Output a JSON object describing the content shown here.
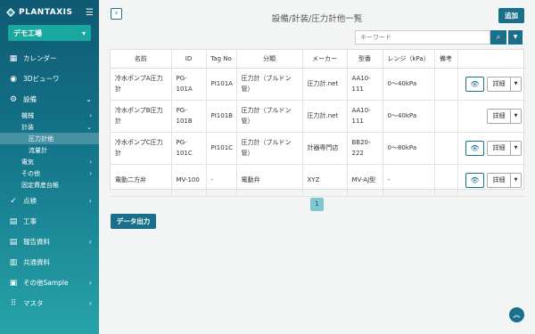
{
  "brand": {
    "name": "PLANTAXIS"
  },
  "factory": {
    "label": "デモ工場"
  },
  "nav": {
    "calendar": "カレンダー",
    "viewer3d": "3Dビューワ",
    "equipment": "設備",
    "machine": "機械",
    "meter": "計装",
    "pressure_meter": "圧力計他",
    "flow_meter": "流量計",
    "electric": "電気",
    "other": "その他",
    "fixed_assets": "固定資産台帳",
    "inspection": "点検",
    "construction": "工事",
    "report": "報告資料",
    "shared": "共通資料",
    "other_sample": "その他Sample",
    "master": "マスタ"
  },
  "header": {
    "title": "設備/計装/圧力計他一覧",
    "add_label": "追加",
    "search_placeholder": "キーワード"
  },
  "table": {
    "headers": {
      "name": "名前",
      "id": "ID",
      "tag": "Tag No",
      "category": "分類",
      "maker": "メーカー",
      "model": "型番",
      "range": "レンジ（kPa）",
      "note": "備考"
    },
    "rows": [
      {
        "name": "冷水ポンプA圧力計",
        "id": "PG-101A",
        "tag": "PI101A",
        "category": "圧力計（ブルドン管）",
        "maker": "圧力計.net",
        "model": "AA10-111",
        "range": "0〜40kPa",
        "note": "",
        "has_view": true
      },
      {
        "name": "冷水ポンプB圧力計",
        "id": "PG-101B",
        "tag": "PI101B",
        "category": "圧力計（ブルドン管）",
        "maker": "圧力計.net",
        "model": "AA10-111",
        "range": "0〜40kPa",
        "note": "",
        "has_view": false
      },
      {
        "name": "冷水ポンプC圧力計",
        "id": "PG-101C",
        "tag": "PI101C",
        "category": "圧力計（ブルドン管）",
        "maker": "計器専門店",
        "model": "BB20-222",
        "range": "0〜80kPa",
        "note": "",
        "has_view": true
      },
      {
        "name": "電動二方弁",
        "id": "MV-100",
        "tag": "-",
        "category": "電動弁",
        "maker": "XYZ",
        "model": "MV-AJ型",
        "range": "-",
        "note": "",
        "has_view": true
      }
    ],
    "detail_label": "詳細"
  },
  "pagination": {
    "current": "1"
  },
  "export": {
    "label": "データ出力"
  },
  "colors": {
    "primary": "#1a6f8a",
    "sidebar_top": "#0f5a73",
    "sidebar_bottom": "#27a3a8"
  }
}
